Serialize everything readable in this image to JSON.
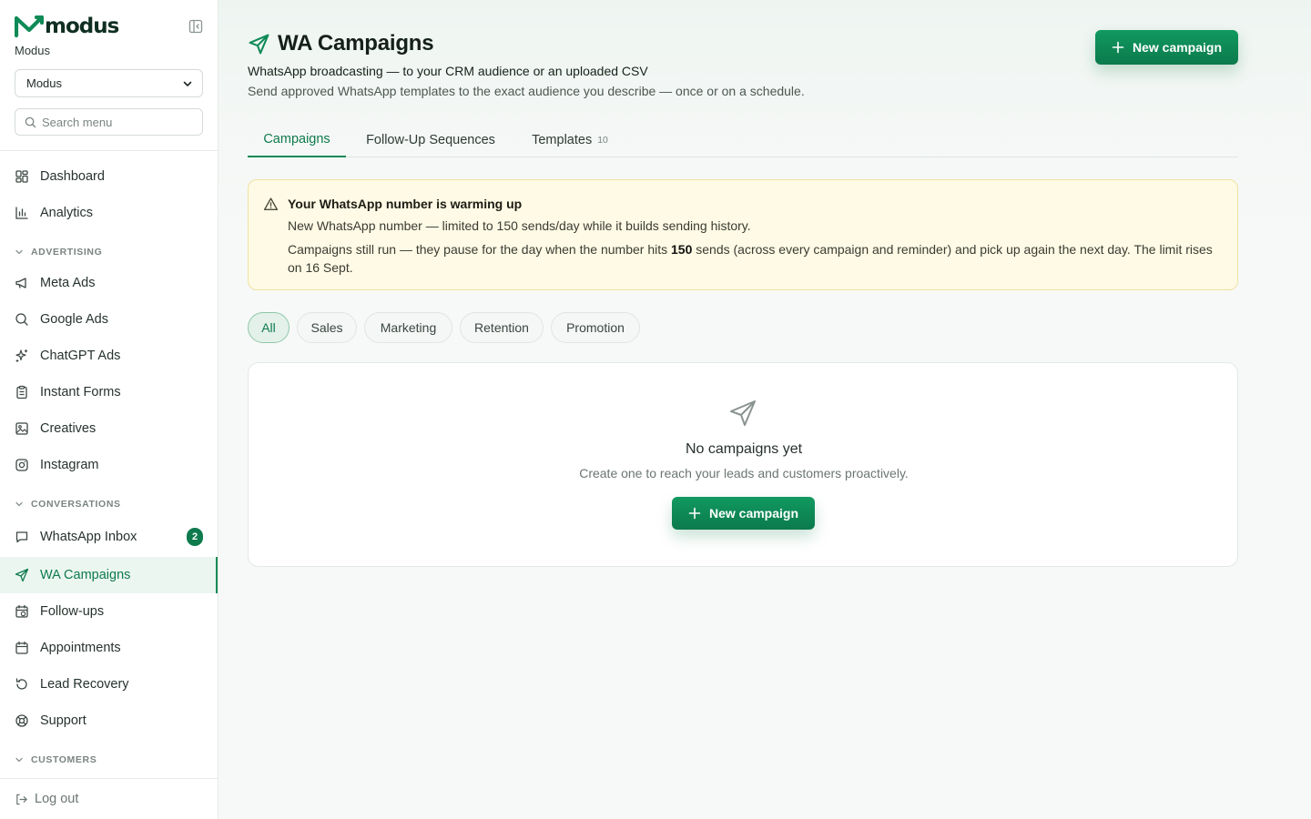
{
  "brand": {
    "name": "modus",
    "org_label": "Modus"
  },
  "org_select": {
    "value": "Modus"
  },
  "menu_search": {
    "placeholder": "Search menu"
  },
  "nav": {
    "dashboard": "Dashboard",
    "analytics": "Analytics",
    "advertising_label": "ADVERTISING",
    "meta_ads": "Meta Ads",
    "google_ads": "Google Ads",
    "chatgpt_ads": "ChatGPT Ads",
    "instant_forms": "Instant Forms",
    "creatives": "Creatives",
    "instagram": "Instagram",
    "conversations_label": "CONVERSATIONS",
    "whatsapp_inbox": "WhatsApp Inbox",
    "whatsapp_inbox_badge": "2",
    "wa_campaigns": "WA Campaigns",
    "follow_ups": "Follow-ups",
    "appointments": "Appointments",
    "lead_recovery": "Lead Recovery",
    "support": "Support",
    "customers_label": "CUSTOMERS",
    "logout": "Log out"
  },
  "header": {
    "title": "WA Campaigns",
    "subtitle": "WhatsApp broadcasting — to your CRM audience or an uploaded CSV",
    "description": "Send approved WhatsApp templates to the exact audience you describe — once or on a schedule.",
    "new_campaign_label": "New campaign"
  },
  "tabs": [
    {
      "label": "Campaigns",
      "active": true
    },
    {
      "label": "Follow-Up Sequences",
      "active": false
    },
    {
      "label": "Templates",
      "count": "10",
      "active": false
    }
  ],
  "alert": {
    "title": "Your WhatsApp number is warming up",
    "line1": "New WhatsApp number — limited to 150 sends/day while it builds sending history.",
    "line2_before": "Campaigns still run — they pause for the day when the number hits ",
    "line2_limit": "150",
    "line2_after": " sends (across every campaign and reminder) and pick up again the next day. The limit rises on 16 Sept."
  },
  "filters": [
    "All",
    "Sales",
    "Marketing",
    "Retention",
    "Promotion"
  ],
  "empty_state": {
    "title": "No campaigns yet",
    "description": "Create one to reach your leads and customers proactively.",
    "button_label": "New campaign"
  },
  "colors": {
    "accent": "#0e7a4e",
    "accent_light": "#ecf6f1",
    "alert_bg": "#fefae5",
    "alert_border": "#f1e1a4"
  },
  "icons": {
    "logo": "modus-logo-icon",
    "collapse": "sidebar-collapse-icon",
    "title": "send-icon",
    "alert": "warning-triangle-icon",
    "empty": "send-icon",
    "new": "plus-icon"
  }
}
